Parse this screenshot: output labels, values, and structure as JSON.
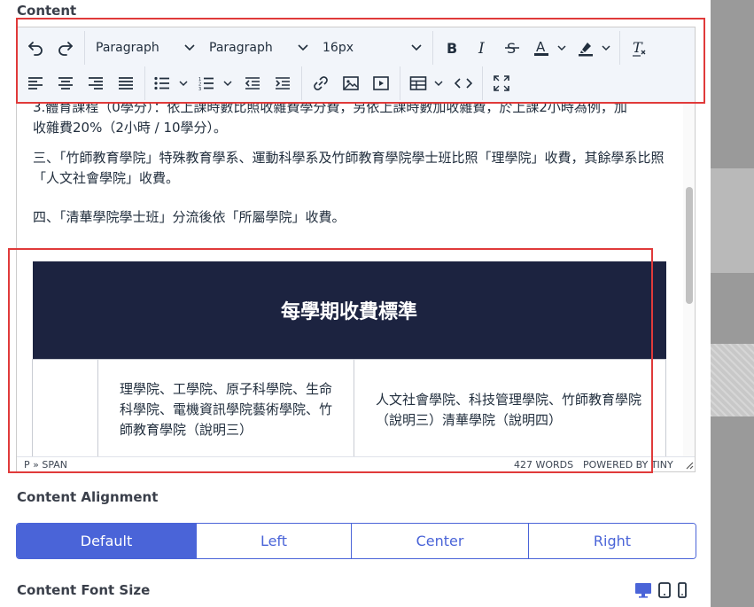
{
  "labels": {
    "content": "Content",
    "content_alignment": "Content Alignment",
    "content_font_size": "Content Font Size"
  },
  "toolbar": {
    "block_format": "Paragraph",
    "font_family": "Paragraph",
    "font_size": "16px",
    "icons": [
      "undo-icon",
      "redo-icon",
      "bold-icon",
      "italic-icon",
      "strikethrough-icon",
      "text-color-icon",
      "highlight-icon",
      "clear-format-icon",
      "align-left-icon",
      "align-center-icon",
      "align-right-icon",
      "justify-icon",
      "bullet-list-icon",
      "numbered-list-icon",
      "outdent-icon",
      "indent-icon",
      "link-icon",
      "image-icon",
      "media-icon",
      "table-icon",
      "code-icon",
      "fullscreen-icon"
    ]
  },
  "editor": {
    "p1_line1": "3.體育課程（0學分）：依上課時數比照收雜費學分費，另依上課時數加收雜費，於上課2小時為例，加",
    "p1_line2": "收雜費20%（2小時 / 10學分）。",
    "p2": "三、「竹師教育學院」特殊教育學系、運動科學系及竹師教育學院學士班比照「理學院」收費，其餘學系比照「人文社會學院」收費。",
    "p3": "四、「清華學院學士班」分流後依「所屬學院」收費。",
    "table_title": "每學期收費標準",
    "col_a": "理學院、工學院、原子科學院、生命科學院、電機資訊學院藝術學院、竹師教育學院（說明三）",
    "col_b": "人文社會學院、科技管理學院、竹師教育學院（說明三）清華學院（說明四）"
  },
  "statusbar": {
    "path": "P » SPAN",
    "words": "427 WORDS",
    "powered": "POWERED BY TINY"
  },
  "alignment": {
    "options": [
      "Default",
      "Left",
      "Center",
      "Right"
    ],
    "selected": "Default"
  },
  "device_icons": [
    "desktop-icon",
    "tablet-icon",
    "mobile-icon"
  ],
  "colors": {
    "accent": "#4a64d8",
    "table_header": "#1c2340",
    "highlight_box": "#e03a3a"
  }
}
